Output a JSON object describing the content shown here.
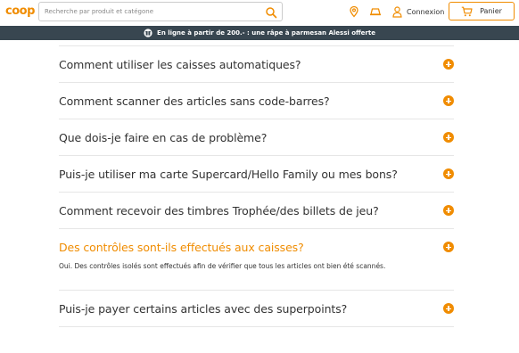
{
  "header": {
    "logo": "coop",
    "search_placeholder": "Recherche par produit et catégone",
    "login_label": "Connexion",
    "cart_label": "Panier",
    "brand_color": "#f08c00"
  },
  "promo": {
    "text": "En ligne à partir de 200.- : une râpe à parmesan Alessi offerte"
  },
  "faq": {
    "items": [
      {
        "question": "Comment utiliser les caisses automatiques?"
      },
      {
        "question": "Comment scanner des articles sans code-barres?"
      },
      {
        "question": "Que dois-je faire en cas de problème?"
      },
      {
        "question": "Puis-je utiliser ma carte Supercard/Hello Family ou mes bons?"
      },
      {
        "question": "Comment recevoir des timbres Trophée/des billets de jeu?"
      },
      {
        "question": "Des contrôles sont-ils effectués aux caisses?",
        "answer": "Oui. Des contrôles isolés sont effectués afin de vérifier que tous les articles ont bien été scannés."
      },
      {
        "question": "Puis-je payer certains articles avec des superpoints?"
      }
    ]
  }
}
